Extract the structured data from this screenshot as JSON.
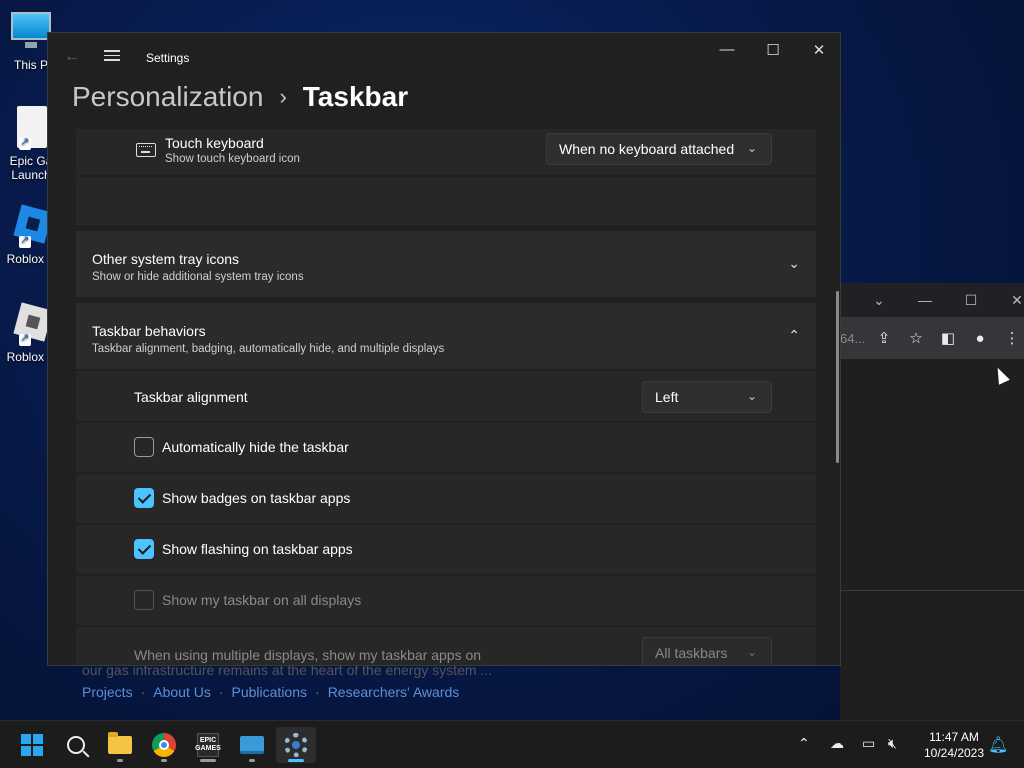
{
  "desktop": {
    "icons": [
      {
        "label": "This P",
        "icon": "monitor-icon"
      },
      {
        "label": "Epic Ga Launch",
        "line1": "Epic Ga",
        "line2": "Launch",
        "icon": "epic-games-icon"
      },
      {
        "label": "Roblox S",
        "icon": "roblox-studio-icon"
      },
      {
        "label": "Roblox P",
        "icon": "roblox-player-icon"
      }
    ]
  },
  "browser": {
    "url_fragment": "64...",
    "page_text": "our gas infrastructure remains at the heart of the energy system ...",
    "links": [
      "Projects",
      "About Us",
      "Publications",
      "Researchers' Awards"
    ],
    "link_separator": "·"
  },
  "settings": {
    "app_title": "Settings",
    "breadcrumb": {
      "parent": "Personalization",
      "separator": "›",
      "current": "Taskbar"
    },
    "touch_keyboard": {
      "title": "Touch keyboard",
      "subtitle": "Show touch keyboard icon",
      "value": "When no keyboard attached"
    },
    "other_tray": {
      "title": "Other system tray icons",
      "subtitle": "Show or hide additional system tray icons"
    },
    "behaviors": {
      "title": "Taskbar behaviors",
      "subtitle": "Taskbar alignment, badging, automatically hide, and multiple displays",
      "alignment_label": "Taskbar alignment",
      "alignment_value": "Left",
      "checkboxes": [
        {
          "label": "Automatically hide the taskbar",
          "checked": false,
          "disabled": false
        },
        {
          "label": "Show badges on taskbar apps",
          "checked": true,
          "disabled": false
        },
        {
          "label": "Show flashing on taskbar apps",
          "checked": true,
          "disabled": false
        },
        {
          "label": "Show my taskbar on all displays",
          "checked": false,
          "disabled": true
        }
      ],
      "multi_display_label": "When using multiple displays, show my taskbar apps on",
      "multi_display_value": "All taskbars"
    }
  },
  "taskbar": {
    "time": "11:47 AM",
    "date": "10/24/2023",
    "accent": "#4cc2ff"
  }
}
